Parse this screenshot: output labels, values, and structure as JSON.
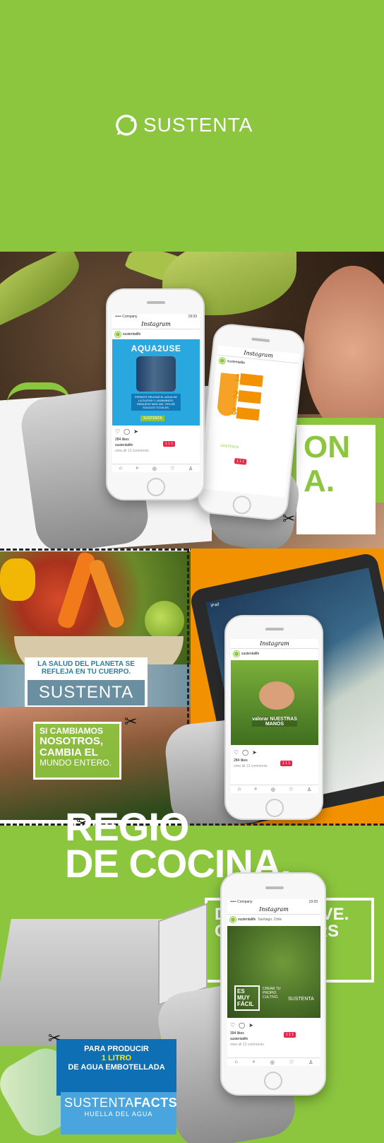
{
  "brand": {
    "name": "SUSTENTA",
    "accent_green": "#8cc63f",
    "accent_blue": "#29a8e0",
    "accent_orange": "#f39200",
    "like_red": "#e6294b"
  },
  "instagram": {
    "app_title": "Instagram",
    "carrier": "••••• Company",
    "time": "19:33",
    "username": "sustentalife",
    "location": "Santiago, Chile",
    "likes": "284 likes",
    "caption_user": "sustentalife",
    "view_comments": "view all 12 comments",
    "likes_alt": "394 likes",
    "badge": "1  1  1"
  },
  "sections": {
    "hero": {
      "logo_text": "SUSTENTA"
    },
    "s1": {
      "post_left": {
        "title": "AQUA2USE",
        "body": "PERMITE REUSAR EL AGUA DE LA DUCHA Y LAVAMANOS, REMUEVE MÁS DEL 75% DE SÓLIDOS TOTALES.",
        "logo": "SUSTENTA"
      },
      "post_right": {
        "steps": [
          "1",
          "2",
          "3"
        ],
        "logo": "SUSTENTA"
      },
      "panel_text_line1": "ON",
      "panel_text_line2": "A."
    },
    "s2": {
      "salud_text": "LA SALUD DEL PLANETA SE REFLEJA EN TU CUERPO.",
      "salud_logo": "SUSTENTA",
      "cambiamos_1": "SI CAMBIAMOS",
      "cambiamos_2": "NOSOTROS,",
      "cambiamos_3": "CAMBIA EL",
      "cambiamos_4": "MUNDO ENTERO.",
      "post_text": "valorar NUESTRAS MANOS",
      "ipad_label": "iPad"
    },
    "s3": {
      "headline_1": "REGIO",
      "headline_2": "DE COCINA.",
      "box_text": "DEN AS AN AVE. CON CM. VERS",
      "post_text_1": "ES MUY FÁCIL",
      "post_text_2": "CREAR TU PROPIO CULTIVO.",
      "post_logo": "SUSTENTA",
      "agua_1": "PARA PRODUCIR",
      "agua_2": "1 LITRO",
      "agua_3": "DE AGUA EMBOTELLADA",
      "facts_1a": "SUSTENTA",
      "facts_1b": "FACTS",
      "facts_2": "HUELLA DEL AGUA"
    }
  },
  "icons": {
    "heart": "♡",
    "comment": "◯",
    "share": "➤",
    "home": "⌂",
    "search": "⌕",
    "camera": "◎",
    "profile": "♙",
    "scissors": "✂"
  }
}
